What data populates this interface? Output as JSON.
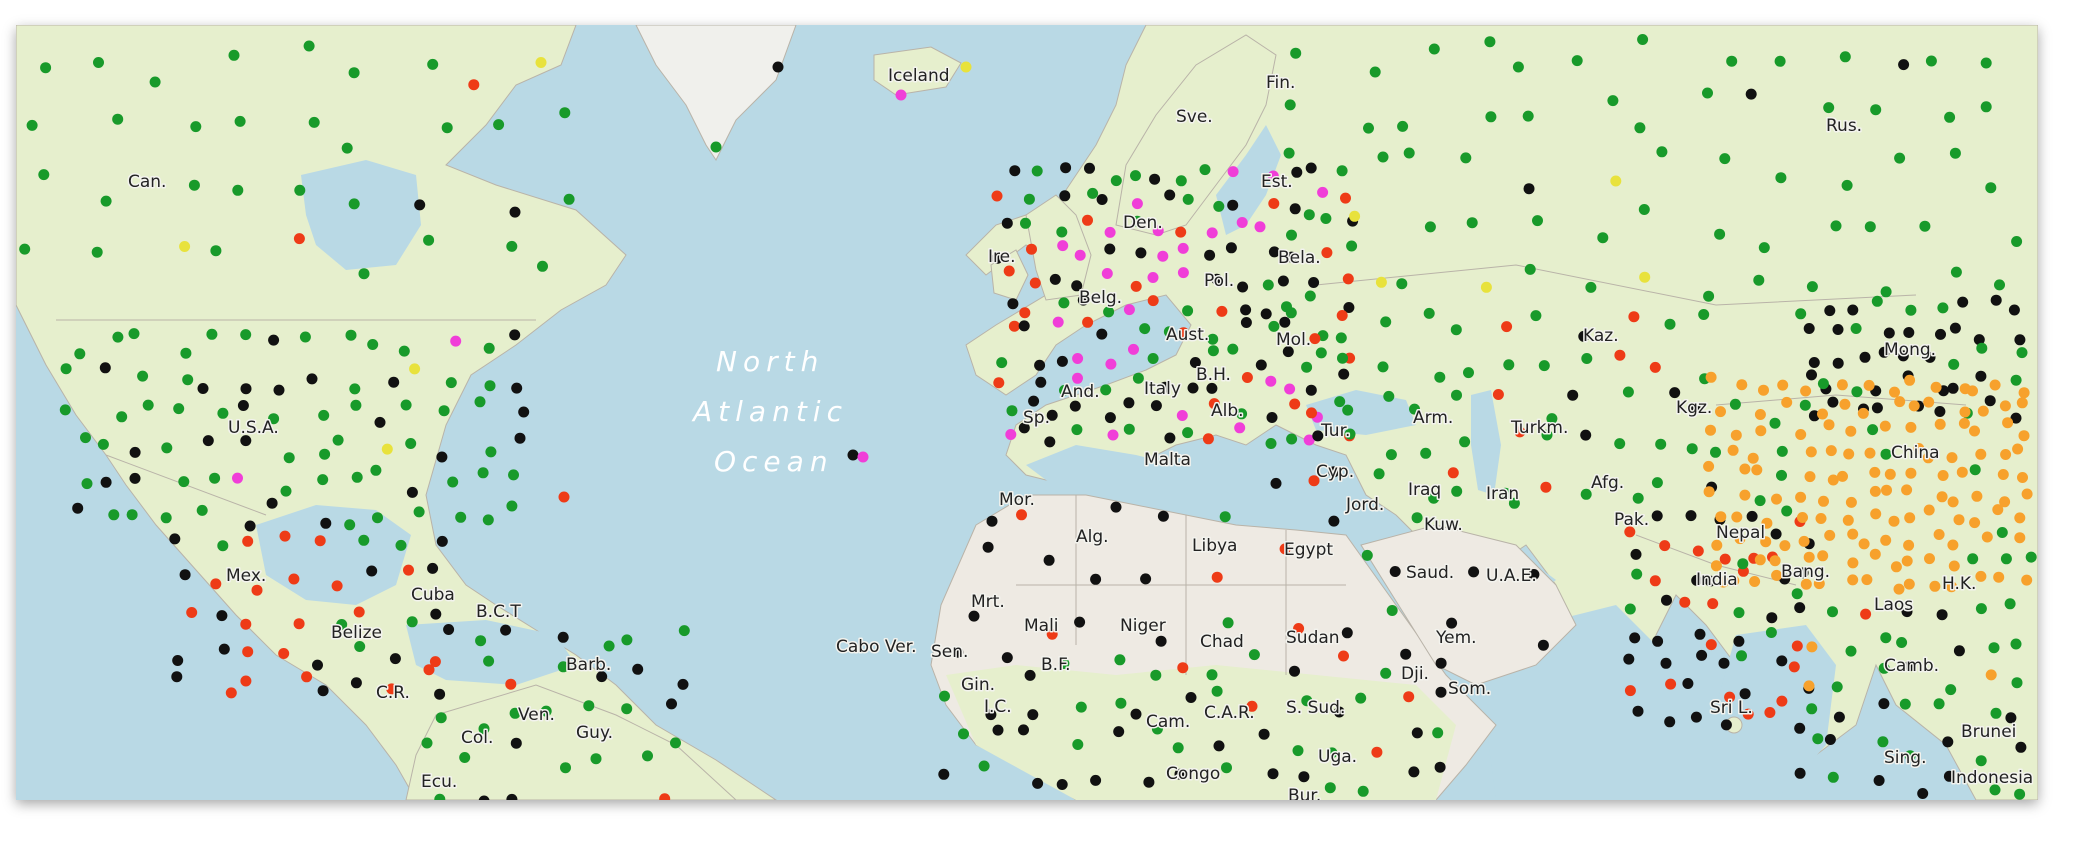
{
  "map": {
    "ocean_label_lines": [
      "North",
      "Atlantic",
      "Ocean"
    ],
    "colors": {
      "water": "#b9d9e5",
      "land": "#e6efcd",
      "desert": "#eeeae3",
      "ice": "#f0f0ec",
      "border": "#b9b3a8",
      "station_green": "#189a2a",
      "station_black": "#111111",
      "station_red": "#ee3b17",
      "station_orange": "#f7a12c",
      "station_magenta": "#f03ed8",
      "station_yellow": "#e8e23c"
    },
    "countries": [
      {
        "id": "can",
        "label": "Can."
      },
      {
        "id": "usa",
        "label": "U.S.A."
      },
      {
        "id": "mex",
        "label": "Mex."
      },
      {
        "id": "cuba",
        "label": "Cuba"
      },
      {
        "id": "bct",
        "label": "B.C.T"
      },
      {
        "id": "belize",
        "label": "Belize"
      },
      {
        "id": "cr",
        "label": "C.R."
      },
      {
        "id": "barb",
        "label": "Barb."
      },
      {
        "id": "ven",
        "label": "Ven."
      },
      {
        "id": "guy",
        "label": "Guy."
      },
      {
        "id": "col",
        "label": "Col."
      },
      {
        "id": "ecu",
        "label": "Ecu."
      },
      {
        "id": "iceland",
        "label": "Iceland"
      },
      {
        "id": "ire",
        "label": "Ire."
      },
      {
        "id": "sve",
        "label": "Sve."
      },
      {
        "id": "fin",
        "label": "Fin."
      },
      {
        "id": "est",
        "label": "Est."
      },
      {
        "id": "den",
        "label": "Den."
      },
      {
        "id": "bela",
        "label": "Bela."
      },
      {
        "id": "pol",
        "label": "Pol."
      },
      {
        "id": "belg",
        "label": "Belg."
      },
      {
        "id": "aust",
        "label": "Aust."
      },
      {
        "id": "mol",
        "label": "Mol."
      },
      {
        "id": "and",
        "label": "And."
      },
      {
        "id": "sp",
        "label": "Sp."
      },
      {
        "id": "italy",
        "label": "Italy"
      },
      {
        "id": "bh",
        "label": "B.H."
      },
      {
        "id": "alb",
        "label": "Alb."
      },
      {
        "id": "malta",
        "label": "Malta"
      },
      {
        "id": "tur",
        "label": "Tur."
      },
      {
        "id": "arm",
        "label": "Arm."
      },
      {
        "id": "cyp",
        "label": "Cyp."
      },
      {
        "id": "jord",
        "label": "Jord."
      },
      {
        "id": "iraq",
        "label": "Iraq"
      },
      {
        "id": "kuw",
        "label": "Kuw."
      },
      {
        "id": "iran",
        "label": "Iran"
      },
      {
        "id": "turkm",
        "label": "Turkm."
      },
      {
        "id": "afg",
        "label": "Afg."
      },
      {
        "id": "pak",
        "label": "Pak."
      },
      {
        "id": "kgz",
        "label": "Kgz."
      },
      {
        "id": "kaz",
        "label": "Kaz."
      },
      {
        "id": "rus",
        "label": "Rus."
      },
      {
        "id": "mong",
        "label": "Mong."
      },
      {
        "id": "china",
        "label": "China"
      },
      {
        "id": "nepal",
        "label": "Nepal"
      },
      {
        "id": "india",
        "label": "India"
      },
      {
        "id": "bang",
        "label": "Bang."
      },
      {
        "id": "laos",
        "label": "Laos"
      },
      {
        "id": "hk",
        "label": "H.K."
      },
      {
        "id": "camb",
        "label": "Camb."
      },
      {
        "id": "sril",
        "label": "Sri L."
      },
      {
        "id": "sing",
        "label": "Sing."
      },
      {
        "id": "brunei",
        "label": "Brunei"
      },
      {
        "id": "indonesia",
        "label": "Indonesia"
      },
      {
        "id": "saud",
        "label": "Saud."
      },
      {
        "id": "uae",
        "label": "U.A.E."
      },
      {
        "id": "yem",
        "label": "Yem."
      },
      {
        "id": "dji",
        "label": "Dji."
      },
      {
        "id": "som",
        "label": "Som."
      },
      {
        "id": "egypt",
        "label": "Egypt"
      },
      {
        "id": "libya",
        "label": "Libya"
      },
      {
        "id": "alg",
        "label": "Alg."
      },
      {
        "id": "mor",
        "label": "Mor."
      },
      {
        "id": "mrt",
        "label": "Mrt."
      },
      {
        "id": "mali",
        "label": "Mali"
      },
      {
        "id": "niger",
        "label": "Niger"
      },
      {
        "id": "chad",
        "label": "Chad"
      },
      {
        "id": "sudan",
        "label": "Sudan"
      },
      {
        "id": "ssud",
        "label": "S. Sud."
      },
      {
        "id": "car",
        "label": "C.A.R."
      },
      {
        "id": "cam",
        "label": "Cam."
      },
      {
        "id": "congo",
        "label": "Congo"
      },
      {
        "id": "uga",
        "label": "Uga."
      },
      {
        "id": "bur",
        "label": "Bur."
      },
      {
        "id": "cabover",
        "label": "Cabo Ver."
      },
      {
        "id": "sen",
        "label": "Sen."
      },
      {
        "id": "gin",
        "label": "Gin."
      },
      {
        "id": "bf",
        "label": "B.F."
      },
      {
        "id": "ic",
        "label": "I.C."
      }
    ]
  }
}
